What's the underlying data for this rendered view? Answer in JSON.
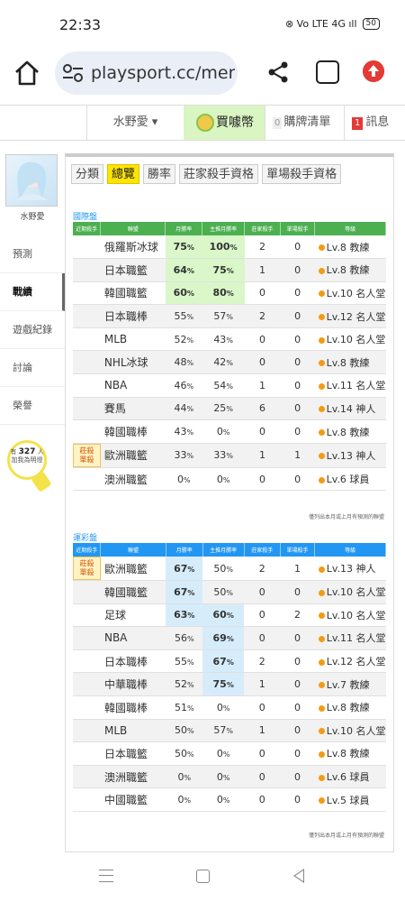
{
  "status": {
    "time": "22:33",
    "icons": "⊗ Vo LTE 4G ıll",
    "battery": "50"
  },
  "browser": {
    "url": "playsport.cc/men"
  },
  "topnav": {
    "user": "水野愛 ▾",
    "buy": "買噱幣",
    "cart_count": "0",
    "cart": "購牌清單",
    "msg_count": "1",
    "msg": "訊息"
  },
  "sidebar": {
    "name": "水野愛",
    "items": [
      "預測",
      "戰績",
      "遊戲紀錄",
      "討論",
      "榮譽"
    ],
    "bulb_pre": "有",
    "bulb_count": "327",
    "bulb_post": "人",
    "bulb_line2": "加我為明燈"
  },
  "filter": {
    "label": "分類",
    "tabs": [
      "總覽",
      "勝率",
      "莊家殺手資格",
      "單場殺手資格"
    ]
  },
  "headers": [
    "近期殺手",
    "聯盟",
    "月勝率",
    "主推月勝率",
    "莊家殺手",
    "單場殺手",
    "等級"
  ],
  "sections": [
    {
      "title": "國際盤",
      "color": "#4caf50",
      "rows": [
        {
          "killer": "",
          "league": "俄羅斯冰球",
          "month": "75",
          "main": "100",
          "dealer": "2",
          "single": "0",
          "level": "Lv.8 教練",
          "hm": true,
          "hmain": true
        },
        {
          "killer": "",
          "league": "日本職籃",
          "month": "64",
          "main": "75",
          "dealer": "1",
          "single": "0",
          "level": "Lv.8 教練",
          "hm": true,
          "hmain": true
        },
        {
          "killer": "",
          "league": "韓國職籃",
          "month": "60",
          "main": "80",
          "dealer": "0",
          "single": "0",
          "level": "Lv.10 名人堂",
          "hm": true,
          "hmain": true
        },
        {
          "killer": "",
          "league": "日本職棒",
          "month": "55",
          "main": "57",
          "dealer": "2",
          "single": "0",
          "level": "Lv.12 名人堂"
        },
        {
          "killer": "",
          "league": "MLB",
          "month": "52",
          "main": "43",
          "dealer": "0",
          "single": "0",
          "level": "Lv.10 名人堂"
        },
        {
          "killer": "",
          "league": "NHL冰球",
          "month": "48",
          "main": "42",
          "dealer": "0",
          "single": "0",
          "level": "Lv.8 教練"
        },
        {
          "killer": "",
          "league": "NBA",
          "month": "46",
          "main": "54",
          "dealer": "1",
          "single": "0",
          "level": "Lv.11 名人堂"
        },
        {
          "killer": "",
          "league": "賽馬",
          "month": "44",
          "main": "25",
          "dealer": "6",
          "single": "0",
          "level": "Lv.14 神人"
        },
        {
          "killer": "",
          "league": "韓國職棒",
          "month": "43",
          "main": "0",
          "dealer": "0",
          "single": "0",
          "level": "Lv.8 教練"
        },
        {
          "killer": "莊殺 單殺",
          "league": "歐洲職籃",
          "month": "33",
          "main": "33",
          "dealer": "1",
          "single": "1",
          "level": "Lv.13 神人"
        },
        {
          "killer": "",
          "league": "澳洲職籃",
          "month": "0",
          "main": "0",
          "dealer": "0",
          "single": "0",
          "level": "Lv.6 球員"
        }
      ],
      "note": "僅列出本月或上月有預測的聯盟"
    },
    {
      "title": "運彩盤",
      "color": "#2196f3",
      "rows": [
        {
          "killer": "莊殺 單殺",
          "league": "歐洲職籃",
          "month": "67",
          "main": "50",
          "dealer": "2",
          "single": "1",
          "level": "Lv.13 神人",
          "hm": true
        },
        {
          "killer": "",
          "league": "韓國職籃",
          "month": "67",
          "main": "50",
          "dealer": "0",
          "single": "0",
          "level": "Lv.10 名人堂",
          "hm": true
        },
        {
          "killer": "",
          "league": "足球",
          "month": "63",
          "main": "60",
          "dealer": "0",
          "single": "2",
          "level": "Lv.10 名人堂",
          "hm": true,
          "hmain": true
        },
        {
          "killer": "",
          "league": "NBA",
          "month": "56",
          "main": "69",
          "dealer": "0",
          "single": "0",
          "level": "Lv.11 名人堂",
          "hmain": true
        },
        {
          "killer": "",
          "league": "日本職棒",
          "month": "55",
          "main": "67",
          "dealer": "2",
          "single": "0",
          "level": "Lv.12 名人堂",
          "hmain": true
        },
        {
          "killer": "",
          "league": "中華職棒",
          "month": "52",
          "main": "75",
          "dealer": "1",
          "single": "0",
          "level": "Lv.7 教練",
          "hmain": true
        },
        {
          "killer": "",
          "league": "韓國職棒",
          "month": "51",
          "main": "0",
          "dealer": "0",
          "single": "0",
          "level": "Lv.8 教練"
        },
        {
          "killer": "",
          "league": "MLB",
          "month": "50",
          "main": "57",
          "dealer": "1",
          "single": "0",
          "level": "Lv.10 名人堂"
        },
        {
          "killer": "",
          "league": "日本職籃",
          "month": "50",
          "main": "0",
          "dealer": "0",
          "single": "0",
          "level": "Lv.8 教練"
        },
        {
          "killer": "",
          "league": "澳洲職籃",
          "month": "0",
          "main": "0",
          "dealer": "0",
          "single": "0",
          "level": "Lv.6 球員"
        },
        {
          "killer": "",
          "league": "中國職籃",
          "month": "0",
          "main": "0",
          "dealer": "0",
          "single": "0",
          "level": "Lv.5 球員"
        }
      ],
      "note": "僅列出本月或上月有預測的聯盟"
    }
  ]
}
